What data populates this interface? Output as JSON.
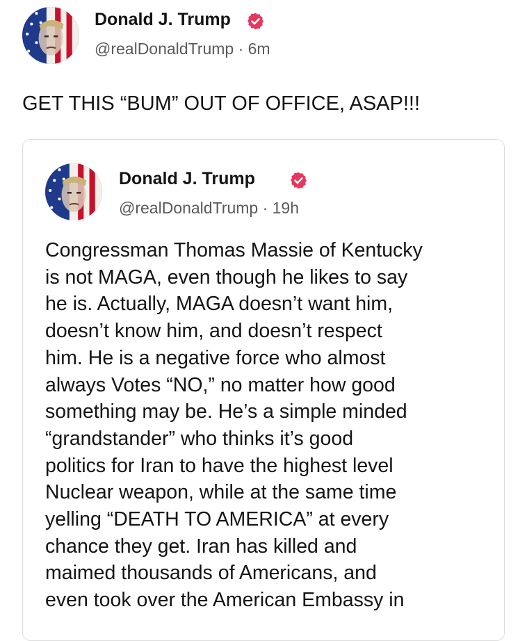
{
  "post": {
    "author_name": "Donald J. Trump",
    "handle_time": "@realDonaldTrump · 6m",
    "text": "GET THIS “BUM” OUT OF OFFICE, ASAP!!!"
  },
  "quoted": {
    "author_name": "Donald J. Trump",
    "handle_time": "@realDonaldTrump · 19h",
    "lines": [
      "Congressman Thomas Massie of Kentucky",
      "is not MAGA, even though he likes to say",
      "he is. Actually, MAGA doesn’t want him,",
      "doesn’t know him, and doesn’t respect",
      "him. He is a negative force who almost",
      "always Votes “NO,” no matter how good",
      "something may be. He’s a simple minded",
      "“grandstander” who thinks it’s good",
      "politics for Iran to have the highest level",
      "Nuclear weapon, while at the same time",
      "yelling “DEATH TO AMERICA” at every",
      "chance they get. Iran has killed and",
      "maimed thousands of Americans, and",
      "even took over the American Embassy in"
    ]
  },
  "icons": {
    "verified": "verified-badge-icon",
    "avatar": "avatar-flag-portrait"
  },
  "colors": {
    "verified_badge": "#e8365d",
    "meta_text": "#5a5a5a",
    "card_border": "#dcdcdc"
  }
}
